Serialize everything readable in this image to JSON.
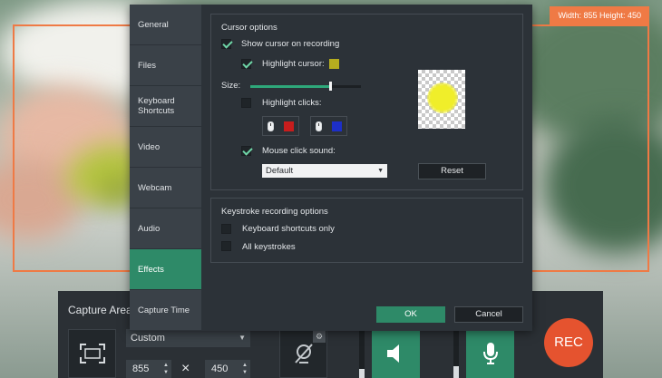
{
  "overlay": {
    "dimensions_label": "Width: 855 Height: 450"
  },
  "settings_nav": [
    {
      "label": "General",
      "active": false
    },
    {
      "label": "Files",
      "active": false
    },
    {
      "label": "Keyboard Shortcuts",
      "active": false
    },
    {
      "label": "Video",
      "active": false
    },
    {
      "label": "Webcam",
      "active": false
    },
    {
      "label": "Audio",
      "active": false
    },
    {
      "label": "Effects",
      "active": true
    },
    {
      "label": "Capture Time",
      "active": false
    }
  ],
  "cursor_options": {
    "title": "Cursor options",
    "show_cursor": {
      "label": "Show cursor on recording",
      "checked": true
    },
    "highlight_cursor": {
      "label": "Highlight cursor:",
      "checked": true,
      "color": "#b5ad1f"
    },
    "size": {
      "label": "Size:",
      "value_fraction": 0.72
    },
    "highlight_clicks": {
      "label": "Highlight clicks:",
      "checked": false,
      "left_click_color": "#c81d1d",
      "right_click_color": "#1d2fc8"
    },
    "mouse_click_sound": {
      "label": "Mouse click sound:",
      "checked": true,
      "selected": "Default"
    },
    "preview_color": "#f0ee2a",
    "reset_label": "Reset"
  },
  "keystroke_options": {
    "title": "Keystroke recording options",
    "keyboard_shortcuts_only": {
      "label": "Keyboard shortcuts only",
      "checked": false
    },
    "all_keystrokes": {
      "label": "All keystrokes",
      "checked": false
    }
  },
  "dialog_buttons": {
    "ok": "OK",
    "cancel": "Cancel"
  },
  "capture_panel": {
    "title": "Capture Area",
    "preset": "Custom",
    "width": "855",
    "times": "×",
    "height": "450",
    "system_audio_level": 0.2,
    "mic_level": 0.25,
    "rec_label": "REC",
    "rec_color": "#e5532f",
    "accent_color": "#2e8a68"
  }
}
